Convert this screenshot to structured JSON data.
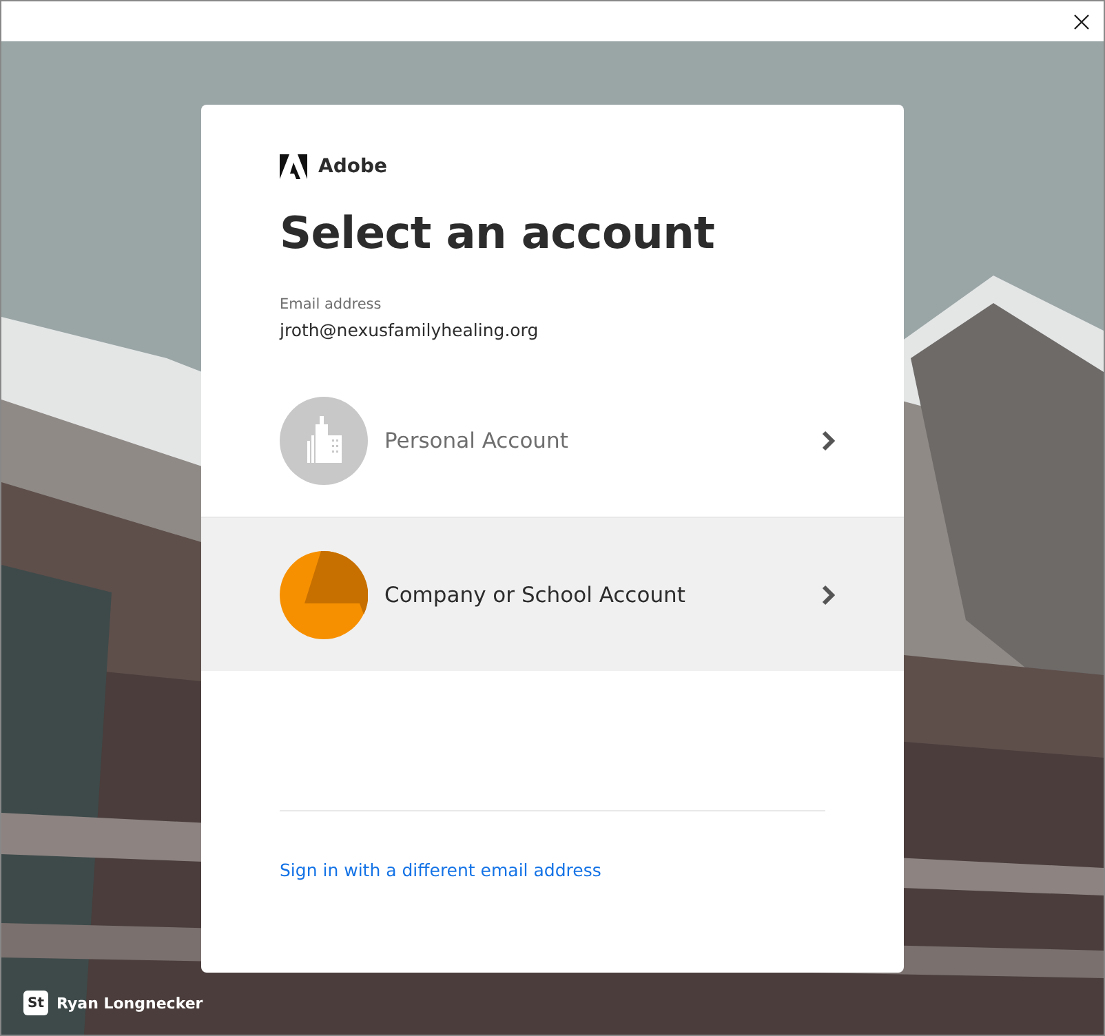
{
  "brand": {
    "name": "Adobe"
  },
  "heading": "Select an account",
  "email": {
    "label": "Email address",
    "value": "jroth@nexusfamilyhealing.org"
  },
  "accounts": [
    {
      "label": "Personal Account",
      "kind": "building",
      "selected": false
    },
    {
      "label": "Company or School Account",
      "kind": "pie",
      "selected": true
    }
  ],
  "link": "Sign in with a different email address",
  "user": {
    "badge": "St",
    "name": "Ryan Longnecker"
  }
}
